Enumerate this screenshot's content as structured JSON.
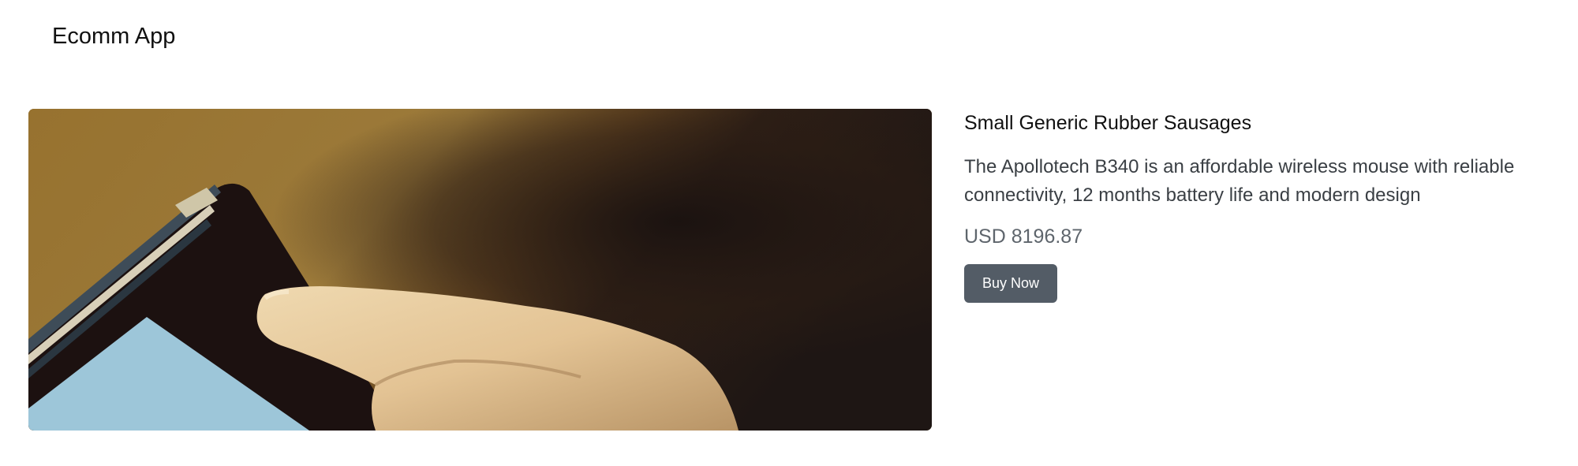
{
  "navbar": {
    "brand": "Ecomm App"
  },
  "product": {
    "title": "Small Generic Rubber Sausages",
    "description": "The Apollotech B340 is an affordable wireless mouse with reliable connectivity, 12 months battery life and modern design",
    "price": "USD 8196.87",
    "buy_label": "Buy Now",
    "image_alt": "Finger touching a tablet screen"
  },
  "colors": {
    "button_bg": "#535c66",
    "price_text": "#5e656c",
    "image_background": "#8c6a2e",
    "tablet_screen": "#9dc6d9"
  }
}
